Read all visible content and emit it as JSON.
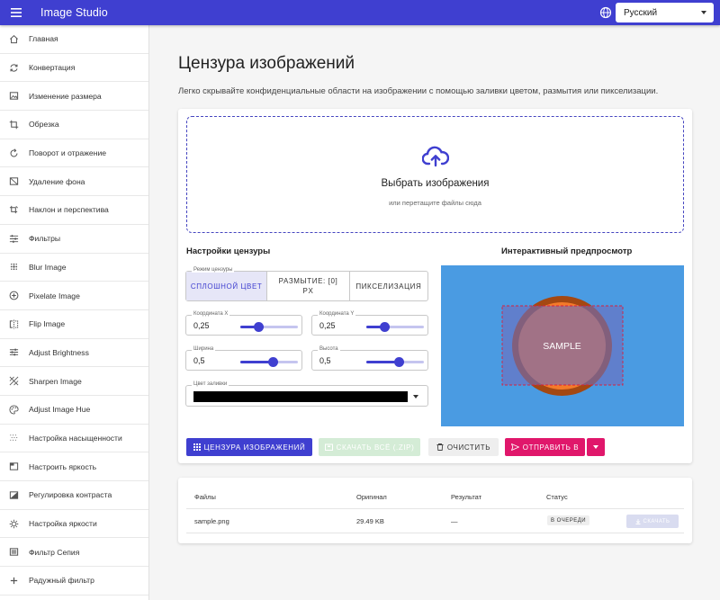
{
  "app": {
    "title": "Image Studio"
  },
  "header": {
    "language": "Русский"
  },
  "sidebar": {
    "items": [
      {
        "label": "Главная",
        "icon": "home-icon"
      },
      {
        "label": "Конвертация",
        "icon": "refresh-icon"
      },
      {
        "label": "Изменение размера",
        "icon": "image-icon"
      },
      {
        "label": "Обрезка",
        "icon": "crop-icon"
      },
      {
        "label": "Поворот и отражение",
        "icon": "rotate-icon"
      },
      {
        "label": "Удаление фона",
        "icon": "background-remove-icon"
      },
      {
        "label": "Наклон и перспектива",
        "icon": "perspective-icon"
      },
      {
        "label": "Фильтры",
        "icon": "tune-icon"
      },
      {
        "label": "Blur Image",
        "icon": "blur-icon"
      },
      {
        "label": "Pixelate Image",
        "icon": "pixelate-icon"
      },
      {
        "label": "Flip Image",
        "icon": "flip-icon"
      },
      {
        "label": "Adjust Brightness",
        "icon": "sliders-icon"
      },
      {
        "label": "Sharpen Image",
        "icon": "sharpen-icon"
      },
      {
        "label": "Adjust Image Hue",
        "icon": "palette-icon"
      },
      {
        "label": "Настройка насыщенности",
        "icon": "saturation-icon"
      },
      {
        "label": "Настроить яркость",
        "icon": "brightness-icon"
      },
      {
        "label": "Регулировка контраста",
        "icon": "contrast-icon"
      },
      {
        "label": "Настройка яркости",
        "icon": "brightness-settings-icon"
      },
      {
        "label": "Фильтр Сепия",
        "icon": "sepia-icon"
      },
      {
        "label": "Радужный фильтр",
        "icon": "plus-circle-icon"
      }
    ]
  },
  "main": {
    "title": "Цензура изображений",
    "description": "Легко скрывайте конфиденциальные области на изображении с помощью заливки цветом, размытия или пикселизации.",
    "dropzone": {
      "title": "Выбрать изображения",
      "subtitle": "или перетащите файлы сюда"
    },
    "settings": {
      "title": "Настройки цензуры",
      "mode_legend": "Режим цензуры",
      "modes": [
        "СПЛОШНОЙ ЦВЕТ",
        "РАЗМЫТИЕ: [0] PX",
        "ПИКСЕЛИЗАЦИЯ"
      ],
      "selected_mode": 0,
      "coord_x": {
        "label": "Координата X",
        "value": "0,25",
        "fraction": 0.25
      },
      "coord_y": {
        "label": "Координата Y",
        "value": "0,25",
        "fraction": 0.25
      },
      "width": {
        "label": "Ширина",
        "value": "0,5",
        "fraction": 0.5
      },
      "height": {
        "label": "Высота",
        "value": "0,5",
        "fraction": 0.5
      },
      "fill_color": {
        "label": "Цвет заливки",
        "value": "#000000"
      }
    },
    "preview": {
      "title": "Интерактивный предпросмотр",
      "sample_text": "SAMPLE",
      "bg_color": "#4a9be2",
      "circle_color": "#f47a2a",
      "ring_color": "#a44812"
    },
    "actions": {
      "censor": "ЦЕНЗУРА ИЗОБРАЖЕНИЙ",
      "download_all": "СКАЧАТЬ ВСЁ (.ZIP)",
      "clear": "ОЧИСТИТЬ",
      "send_to": "ОТПРАВИТЬ В"
    },
    "files_table": {
      "headers": {
        "files": "Файлы",
        "original": "Оригинал",
        "result": "Результат",
        "status": "Статус"
      },
      "rows": [
        {
          "name": "sample.png",
          "original": "29.49 KB",
          "result": "—",
          "status": "В ОЧЕРЕДИ",
          "download": "СКАЧАТЬ"
        }
      ]
    }
  },
  "colors": {
    "primary": "#3f3fd0",
    "accent": "#e0176b",
    "success_disabled": "#d4ecd6"
  }
}
